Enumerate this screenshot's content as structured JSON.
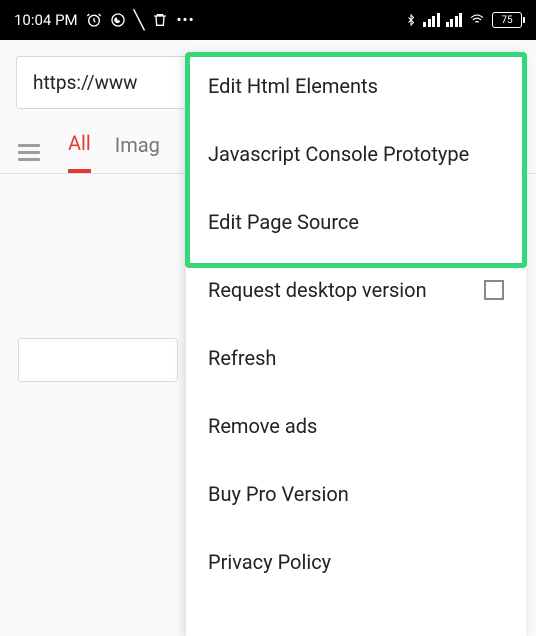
{
  "status_bar": {
    "time": "10:04 PM",
    "battery": "75"
  },
  "url_bar": {
    "url": "https://www"
  },
  "tabs": {
    "all": "All",
    "images": "Imag"
  },
  "menu": {
    "items": [
      "Edit Html Elements",
      "Javascript Console Prototype",
      "Edit Page Source",
      "Request desktop version",
      "Refresh",
      "Remove ads",
      "Buy Pro Version",
      "Privacy Policy"
    ]
  }
}
